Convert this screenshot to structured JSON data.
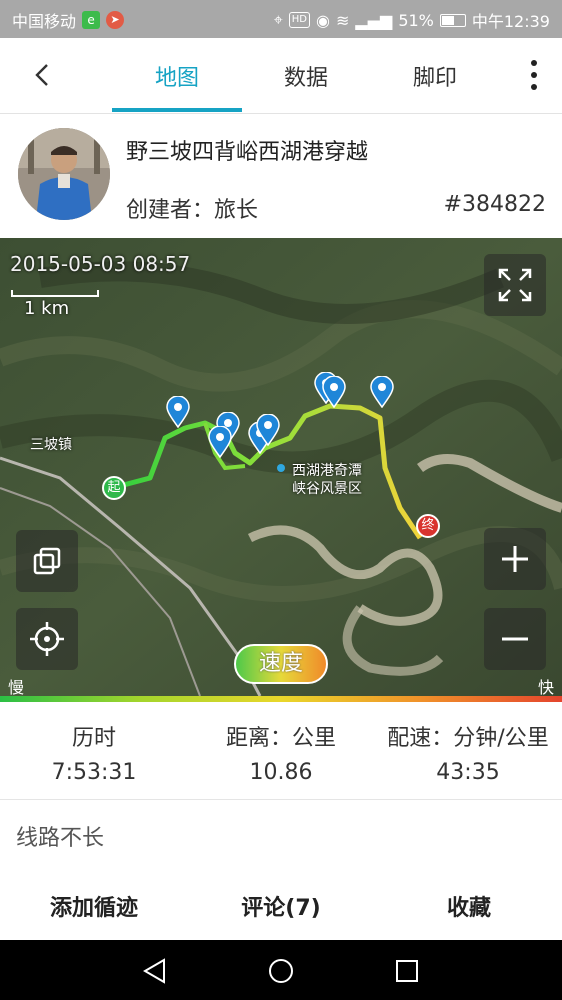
{
  "status_bar": {
    "carrier": "中国移动",
    "battery": "51%",
    "time": "中午12:39"
  },
  "nav": {
    "tabs": [
      {
        "label": "地图",
        "active": true
      },
      {
        "label": "数据",
        "active": false
      },
      {
        "label": "脚印",
        "active": false
      }
    ],
    "accent_color": "#16a3c4"
  },
  "route": {
    "title": "野三坡四背峪西湖港穿越",
    "creator_label": "创建者：",
    "creator_name": "旅长",
    "id": "#384822"
  },
  "map": {
    "timestamp": "2015-05-03 08:57",
    "scale": "1 km",
    "place_labels": [
      "三坡镇",
      "西湖港奇潭",
      "峡谷风景区"
    ],
    "start_marker": "起",
    "end_marker": "终",
    "speed_button": "速度",
    "slow_label": "慢",
    "fast_label": "快"
  },
  "stats": [
    {
      "label": "历时",
      "value": "7:53:31"
    },
    {
      "label": "距离：公里",
      "value": "10.86"
    },
    {
      "label": "配速：分钟/公里",
      "value": "43:35"
    }
  ],
  "description": "线路不长",
  "actions": {
    "add_track": "添加循迹",
    "comments": "评论(7)",
    "favorite": "收藏"
  }
}
